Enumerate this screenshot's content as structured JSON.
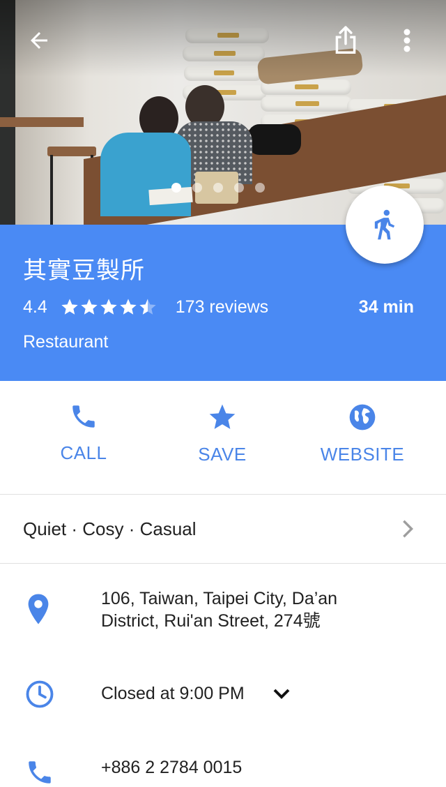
{
  "header": {
    "title": "其實豆製所",
    "rating": "4.4",
    "rating_value": 4.4,
    "reviews": "173 reviews",
    "duration": "34 min",
    "category": "Restaurant"
  },
  "photo_carousel": {
    "count": 5,
    "active_index": 0
  },
  "top_bar": {
    "back_icon": "arrow-left-icon",
    "share_icon": "share-icon",
    "more_icon": "more-vert-icon"
  },
  "actions": [
    {
      "label": "CALL",
      "icon": "phone-icon"
    },
    {
      "label": "SAVE",
      "icon": "star-icon"
    },
    {
      "label": "WEBSITE",
      "icon": "globe-icon"
    }
  ],
  "tags": {
    "text": "Quiet · Cosy · Casual"
  },
  "address": {
    "line1": "106, Taiwan, Taipei City, Da’an",
    "line2": "District, Rui'an Street, 274號"
  },
  "hours": {
    "text": "Closed at 9:00 PM"
  },
  "phone": {
    "text": "+886 2 2784 0015"
  },
  "colors": {
    "header_blue": "#4a8af4",
    "action_blue": "#4a85e8",
    "closed_red": "#d23f31"
  }
}
